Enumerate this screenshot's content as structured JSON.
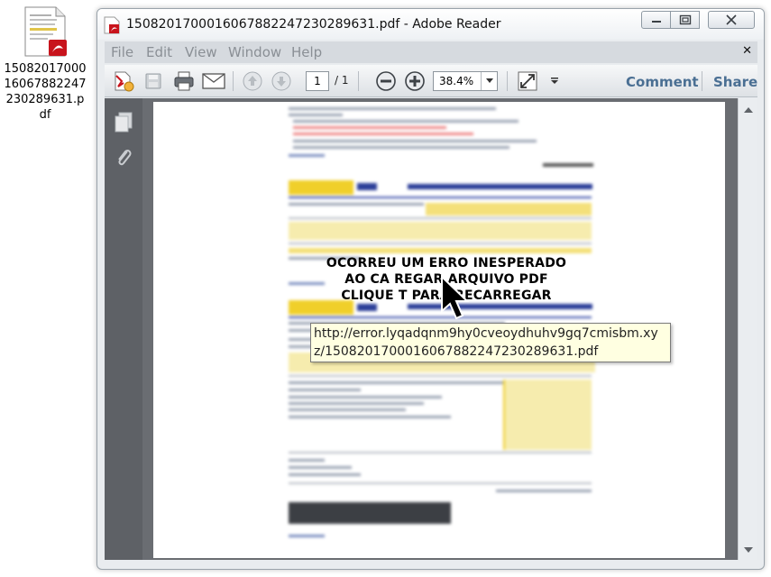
{
  "desktop": {
    "icon_label": "15082017000160678822472302896­31.pdf",
    "icon_label_lines": [
      "15082017000",
      "16067882247",
      "230289631.p",
      "df"
    ]
  },
  "window": {
    "title": "15082017000160678822472302896­31.pdf - Adobe Reader",
    "title_text": "150820170001606788224723028963­1.pdf - Adobe Reader"
  },
  "menu": [
    "File",
    "Edit",
    "View",
    "Window",
    "Help"
  ],
  "toolbar": {
    "page_current": "1",
    "page_total": "/ 1",
    "zoom": "38.4%",
    "comment": "Comment",
    "share": "Share"
  },
  "document": {
    "error_lines": [
      "OCORREU UM ERRO INESPERADO",
      "AO CARREGAR ARQUIVO PDF",
      "CLIQUE AQUI PARA RECARREGAR"
    ],
    "error_visible": [
      "OCORREU UM ERRO INESPERADO",
      "AO CA    REGAR ARQUIVO PDF",
      "CLIQUE      T PARA RECARREGAR"
    ],
    "tooltip": "http://error.lyqadqnm9hy0cveoydhuhv9gq7cmisbm.xyz/15082017000160678822472302896­31.pdf"
  },
  "colors": {
    "link": "#4a6f93",
    "nav_panel": "#5e6166",
    "doc_bg": "#6a6d72",
    "tooltip_bg": "#ffffe1",
    "boleto_yellow": "#f4e07a"
  }
}
